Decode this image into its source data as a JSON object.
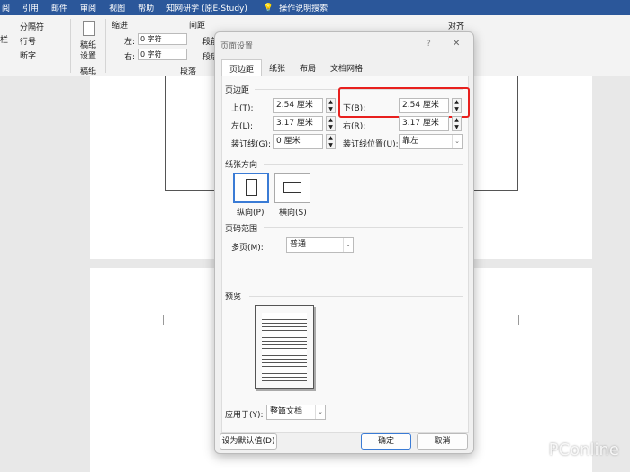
{
  "ribbon_tabs": [
    "阅",
    "引用",
    "邮件",
    "审阅",
    "视图",
    "帮助",
    "知网研学 (原E-Study)",
    "操作说明搜索"
  ],
  "ribbon": {
    "break": "分隔符",
    "line_no": "行号",
    "hyphen": "断字",
    "draft_l1": "稿纸",
    "draft_l2": "设置",
    "draft_group": "稿纸",
    "indent": "缩进",
    "spacing": "间距",
    "left": "左:",
    "right": "右:",
    "left_val": "0 字符",
    "right_val": "0 字符",
    "para_group": "段落",
    "align": "对齐",
    "seg1": "段前",
    "seg2": "段后",
    "col": "栏"
  },
  "dialog": {
    "title": "页面设置",
    "help": "?",
    "close": "✕",
    "tabs": [
      "页边距",
      "纸张",
      "布局",
      "文档网格"
    ],
    "margins_section": "页边距",
    "top_label": "上(T):",
    "top_val": "2.54 厘米",
    "bottom_label": "下(B):",
    "bottom_val": "2.54 厘米",
    "left_label": "左(L):",
    "left_val": "3.17 厘米",
    "right_label": "右(R):",
    "right_val": "3.17 厘米",
    "gutter_label": "装订线(G):",
    "gutter_val": "0 厘米",
    "gutter_pos_label": "装订线位置(U):",
    "gutter_pos_val": "靠左",
    "orientation_section": "纸张方向",
    "portrait": "纵向(P)",
    "landscape": "横向(S)",
    "pages_section": "页码范围",
    "multi_label": "多页(M):",
    "multi_val": "普通",
    "preview_section": "预览",
    "apply_label": "应用于(Y):",
    "apply_val": "整篇文档",
    "default_btn": "设为默认值(D)",
    "ok_btn": "确定",
    "cancel_btn": "取消",
    "highlight_color": "#e8201e"
  },
  "watermark": "PConline"
}
